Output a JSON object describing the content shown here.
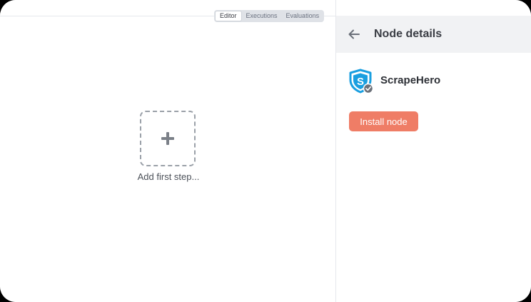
{
  "mode_tabs": [
    {
      "label": "Editor",
      "active": true
    },
    {
      "label": "Executions",
      "active": false
    },
    {
      "label": "Evaluations",
      "active": false
    }
  ],
  "canvas": {
    "add_step_label": "Add first step...",
    "add_icon": "plus-icon"
  },
  "panel": {
    "title": "Node details",
    "back_icon": "arrow-left-icon",
    "node": {
      "name": "ScrapeHero",
      "logo_icon": "scrapehero-shield-logo-icon",
      "verified_icon": "verified-check-icon",
      "install_label": "Install node"
    }
  },
  "colors": {
    "accent": "#ef7d66",
    "logo_blue": "#1a9fe0",
    "panel_header_bg": "#f1f2f4"
  }
}
